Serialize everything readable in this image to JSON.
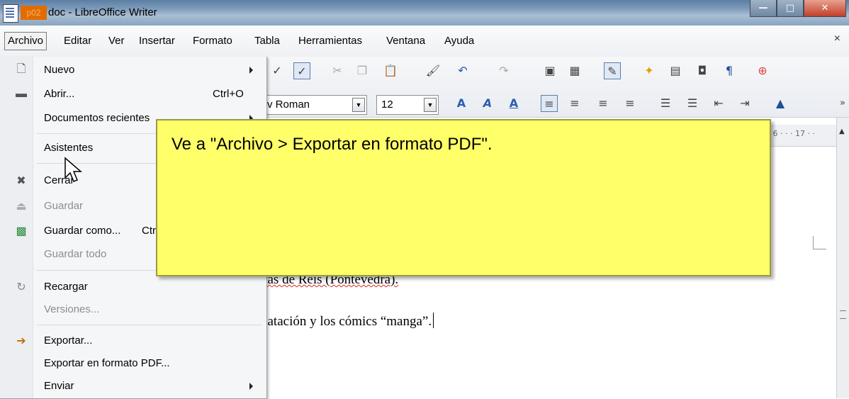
{
  "window": {
    "doc_prefix": "p02",
    "title": "doc - LibreOffice Writer",
    "controls": {
      "minimize": "—",
      "maximize": "□",
      "close": "✕"
    }
  },
  "menubar": {
    "items": [
      {
        "label": "Archivo",
        "active": true
      },
      {
        "label": "Editar"
      },
      {
        "label": "Ver"
      },
      {
        "label": "Insertar"
      },
      {
        "label": "Formato"
      },
      {
        "label": "Tabla"
      },
      {
        "label": "Herramientas"
      },
      {
        "label": "Ventana"
      },
      {
        "label": "Ayuda"
      }
    ],
    "close": "×"
  },
  "toolbar": {
    "font_name": "v Roman",
    "font_size": "12",
    "overflow": "»"
  },
  "ruler": {
    "marks": "6 · · · 17 · ·"
  },
  "document": {
    "line1": "das de Reis (Pontevedra).",
    "line2": "natación y los cómics “manga”."
  },
  "file_menu": {
    "items": [
      {
        "label": "Nuevo",
        "icon": "new-document-icon",
        "submenu": true
      },
      {
        "label": "Abrir...",
        "shortcut": "Ctrl+O",
        "icon": "open-folder-icon"
      },
      {
        "label": "Documentos recientes",
        "submenu": true
      },
      {
        "label": "Asistentes",
        "submenu": true
      },
      {
        "label": "Cerrar",
        "icon": "close-document-icon"
      },
      {
        "label": "Guardar",
        "icon": "save-icon",
        "disabled": true
      },
      {
        "label": "Guardar como...",
        "shortcut": "Ctrl+Mayús+S",
        "icon": "save-as-icon"
      },
      {
        "label": "Guardar todo",
        "disabled": true
      },
      {
        "label": "Recargar",
        "icon": "reload-icon"
      },
      {
        "label": "Versiones...",
        "disabled": true
      },
      {
        "label": "Exportar...",
        "icon": "export-icon"
      },
      {
        "label": "Exportar en formato PDF..."
      },
      {
        "label": "Enviar",
        "submenu": true
      }
    ]
  },
  "callout": {
    "text": "Ve a \"Archivo > Exportar en formato PDF\"."
  },
  "colors": {
    "callout_bg": "#ffff6a",
    "doc_prefix_bg": "#e26c00",
    "spell_error": "#dd2222"
  }
}
